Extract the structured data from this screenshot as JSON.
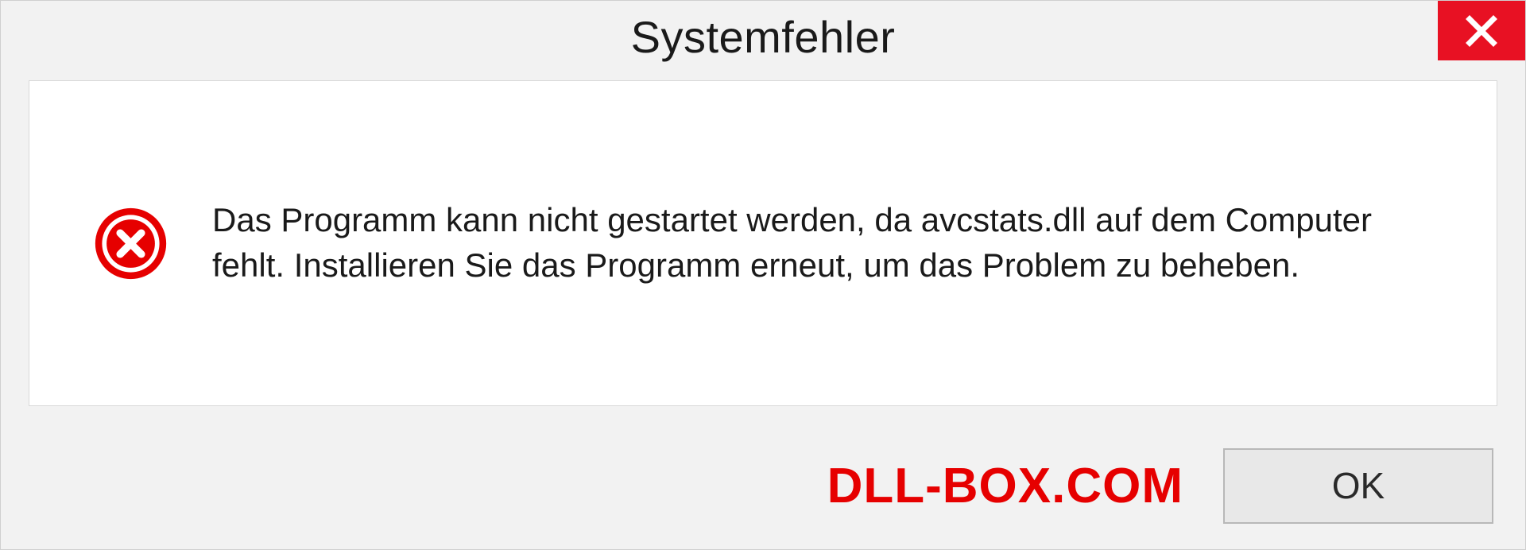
{
  "dialog": {
    "title": "Systemfehler",
    "message": "Das Programm kann nicht gestartet werden, da avcstats.dll auf dem Computer fehlt. Installieren Sie das Programm erneut, um das Problem zu beheben.",
    "ok_label": "OK"
  },
  "watermark": "DLL-BOX.COM",
  "colors": {
    "close_button": "#e81123",
    "error_icon": "#e60000",
    "watermark": "#e60000"
  }
}
